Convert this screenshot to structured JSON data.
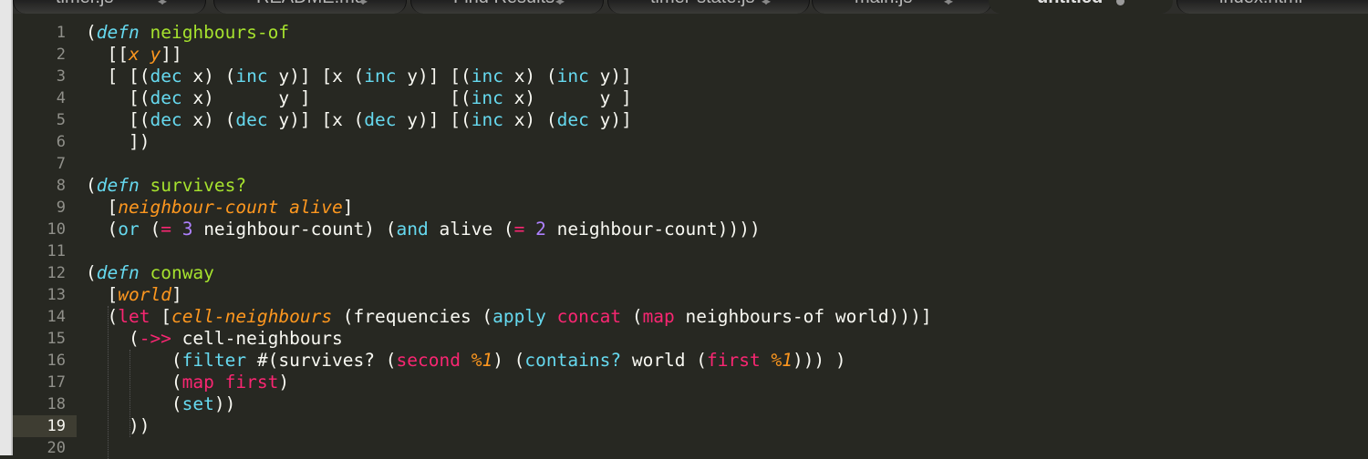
{
  "tabs": [
    {
      "label": "timer.js"
    },
    {
      "label": "README.md"
    },
    {
      "label": "Find Results"
    },
    {
      "label": "timer-state.js"
    },
    {
      "label": "main.js"
    },
    {
      "label": "untitled"
    },
    {
      "label": "index.html"
    }
  ],
  "line_numbers": [
    "1",
    "2",
    "3",
    "4",
    "5",
    "6",
    "7",
    "8",
    "9",
    "10",
    "11",
    "12",
    "13",
    "14",
    "15",
    "16",
    "17",
    "18",
    "19",
    "20"
  ],
  "current_line": "19",
  "code_lines": [
    [
      {
        "t": "("
      },
      {
        "t": "defn",
        "c": "k"
      },
      {
        "t": " "
      },
      {
        "t": "neighbours-of",
        "c": "f"
      }
    ],
    [
      {
        "t": "  [["
      },
      {
        "t": "x y",
        "c": "p"
      },
      {
        "t": "]]"
      }
    ],
    [
      {
        "t": "  [ [("
      },
      {
        "t": "dec",
        "c": "b"
      },
      {
        "t": " x) ("
      },
      {
        "t": "inc",
        "c": "b"
      },
      {
        "t": " y)] [x ("
      },
      {
        "t": "inc",
        "c": "b"
      },
      {
        "t": " y)] [("
      },
      {
        "t": "inc",
        "c": "b"
      },
      {
        "t": " x) ("
      },
      {
        "t": "inc",
        "c": "b"
      },
      {
        "t": " y)]"
      }
    ],
    [
      {
        "t": "    [("
      },
      {
        "t": "dec",
        "c": "b"
      },
      {
        "t": " x)      y ]             [("
      },
      {
        "t": "inc",
        "c": "b"
      },
      {
        "t": " x)      y ]"
      }
    ],
    [
      {
        "t": "    [("
      },
      {
        "t": "dec",
        "c": "b"
      },
      {
        "t": " x) ("
      },
      {
        "t": "dec",
        "c": "b"
      },
      {
        "t": " y)] [x ("
      },
      {
        "t": "dec",
        "c": "b"
      },
      {
        "t": " y)] [("
      },
      {
        "t": "inc",
        "c": "b"
      },
      {
        "t": " x) ("
      },
      {
        "t": "dec",
        "c": "b"
      },
      {
        "t": " y)]"
      }
    ],
    [
      {
        "t": "    ])"
      }
    ],
    [],
    [
      {
        "t": "("
      },
      {
        "t": "defn",
        "c": "k"
      },
      {
        "t": " "
      },
      {
        "t": "survives?",
        "c": "f"
      }
    ],
    [
      {
        "t": "  ["
      },
      {
        "t": "neighbour-count alive",
        "c": "p"
      },
      {
        "t": "]"
      }
    ],
    [
      {
        "t": "  ("
      },
      {
        "t": "or",
        "c": "b"
      },
      {
        "t": " ("
      },
      {
        "t": "=",
        "c": "r"
      },
      {
        "t": " "
      },
      {
        "t": "3",
        "c": "n"
      },
      {
        "t": " neighbour-count) ("
      },
      {
        "t": "and",
        "c": "b"
      },
      {
        "t": " alive ("
      },
      {
        "t": "=",
        "c": "r"
      },
      {
        "t": " "
      },
      {
        "t": "2",
        "c": "n"
      },
      {
        "t": " neighbour-count))))"
      }
    ],
    [],
    [
      {
        "t": "("
      },
      {
        "t": "defn",
        "c": "k"
      },
      {
        "t": " "
      },
      {
        "t": "conway",
        "c": "f"
      }
    ],
    [
      {
        "t": "  ["
      },
      {
        "t": "world",
        "c": "p"
      },
      {
        "t": "]"
      }
    ],
    [
      {
        "t": "  ("
      },
      {
        "t": "let",
        "c": "r"
      },
      {
        "t": " ["
      },
      {
        "t": "cell-neighbours",
        "c": "p"
      },
      {
        "t": " (frequencies ("
      },
      {
        "t": "apply",
        "c": "b"
      },
      {
        "t": " "
      },
      {
        "t": "concat",
        "c": "r"
      },
      {
        "t": " ("
      },
      {
        "t": "map",
        "c": "r"
      },
      {
        "t": " neighbours-of world)))]"
      }
    ],
    [
      {
        "t": "    ("
      },
      {
        "t": "->>",
        "c": "r"
      },
      {
        "t": " cell-neighbours"
      }
    ],
    [
      {
        "t": "        ("
      },
      {
        "t": "filter",
        "c": "b"
      },
      {
        "t": " #(survives? ("
      },
      {
        "t": "second",
        "c": "r"
      },
      {
        "t": " "
      },
      {
        "t": "%1",
        "c": "p"
      },
      {
        "t": ") ("
      },
      {
        "t": "contains?",
        "c": "b"
      },
      {
        "t": " world ("
      },
      {
        "t": "first",
        "c": "r"
      },
      {
        "t": " "
      },
      {
        "t": "%1",
        "c": "p"
      },
      {
        "t": "))) )"
      }
    ],
    [
      {
        "t": "        ("
      },
      {
        "t": "map",
        "c": "r"
      },
      {
        "t": " "
      },
      {
        "t": "first",
        "c": "r"
      },
      {
        "t": ")"
      }
    ],
    [
      {
        "t": "        ("
      },
      {
        "t": "set",
        "c": "b"
      },
      {
        "t": "))"
      }
    ],
    [
      {
        "t": "    ))"
      }
    ],
    []
  ]
}
